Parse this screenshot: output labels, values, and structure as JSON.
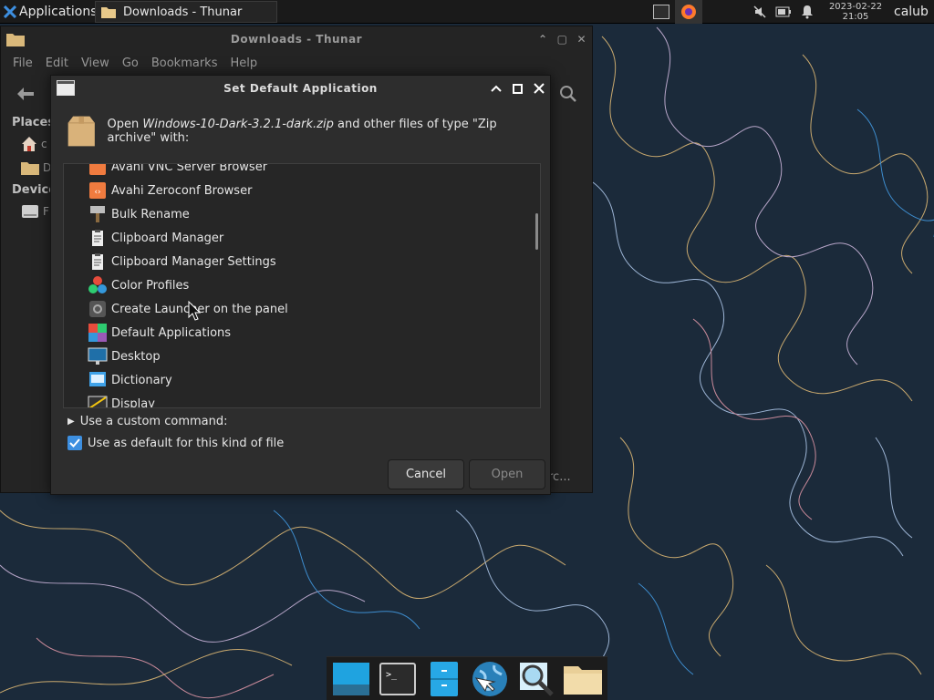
{
  "topbar": {
    "apps_label": "Applications",
    "task_label": "Downloads - Thunar",
    "clock_date": "2023-02-22",
    "clock_time": "21:05",
    "user": "calub"
  },
  "thunar": {
    "title": "Downloads - Thunar",
    "menu": [
      "File",
      "Edit",
      "View",
      "Go",
      "Bookmarks",
      "Help"
    ],
    "places_header": "Places",
    "devices_header": "Devices",
    "places": [
      "c",
      "D"
    ],
    "devices": [
      "F"
    ],
    "status_fragment": "rc..."
  },
  "dialog": {
    "title": "Set Default Application",
    "open_prefix": "Open",
    "file_name": "Windows-10-Dark-3.2.1-dark.zip",
    "open_suffix": "and other files of type \"Zip archive\" with:",
    "apps": [
      {
        "label": "Avahi VNC Server Browser",
        "icon": "avahi-vnc-icon"
      },
      {
        "label": "Avahi Zeroconf Browser",
        "icon": "avahi-zeroconf-icon"
      },
      {
        "label": "Bulk Rename",
        "icon": "bulk-rename-icon"
      },
      {
        "label": "Clipboard Manager",
        "icon": "clipboard-icon"
      },
      {
        "label": "Clipboard Manager Settings",
        "icon": "clipboard-settings-icon"
      },
      {
        "label": "Color Profiles",
        "icon": "color-profiles-icon"
      },
      {
        "label": "Create Launcher on the panel",
        "icon": "launcher-icon"
      },
      {
        "label": "Default Applications",
        "icon": "default-apps-icon"
      },
      {
        "label": "Desktop",
        "icon": "desktop-icon"
      },
      {
        "label": "Dictionary",
        "icon": "dictionary-icon"
      },
      {
        "label": "Display",
        "icon": "display-icon"
      }
    ],
    "custom_command_label": "Use a custom command:",
    "default_label": "Use as default for this kind of file",
    "default_checked": true,
    "cancel_label": "Cancel",
    "open_label": "Open"
  },
  "dock": [
    "show-desktop-icon",
    "terminal-icon",
    "file-manager-icon",
    "browser-icon",
    "search-icon",
    "folder-icon"
  ],
  "colors": {
    "accent": "#3d8fe0",
    "wallpaper": "#1b2a3a",
    "panel": "#1a1a1a"
  }
}
